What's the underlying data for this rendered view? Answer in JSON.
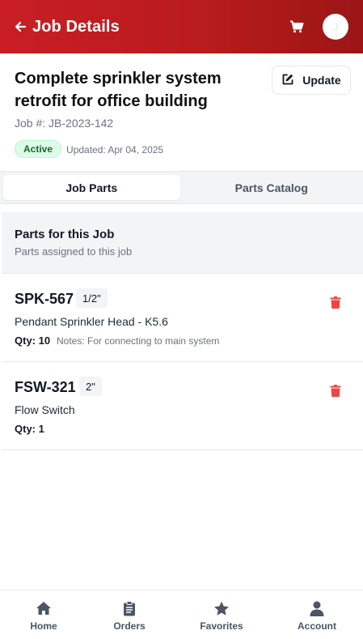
{
  "header": {
    "title": "Job Details",
    "avatar_initial": "J"
  },
  "job": {
    "title": "Complete sprinkler system retrofit for office building",
    "number": "Job #: JB-2023-142",
    "status": "Active",
    "updated": "Updated: Apr 04, 2025",
    "update_label": "Update"
  },
  "tabs": [
    {
      "label": "Job Parts",
      "active": true
    },
    {
      "label": "Parts Catalog",
      "active": false
    }
  ],
  "section": {
    "title": "Parts for this Job",
    "subtitle": "Parts assigned to this job"
  },
  "parts": [
    {
      "sku": "SPK-567",
      "size": "1/2\"",
      "name": "Pendant Sprinkler Head - K5.6",
      "qty": "Qty: 10",
      "notes": "Notes: For connecting to main system"
    },
    {
      "sku": "FSW-321",
      "size": "2\"",
      "name": "Flow Switch",
      "qty": "Qty: 1",
      "notes": ""
    }
  ],
  "nav": [
    {
      "label": "Home",
      "icon": "home-icon"
    },
    {
      "label": "Orders",
      "icon": "clipboard-icon"
    },
    {
      "label": "Favorites",
      "icon": "star-icon"
    },
    {
      "label": "Account",
      "icon": "user-icon"
    }
  ],
  "colors": {
    "header_red": "#c81e24",
    "active_green": "#166534",
    "delete_red": "#ef4444"
  }
}
